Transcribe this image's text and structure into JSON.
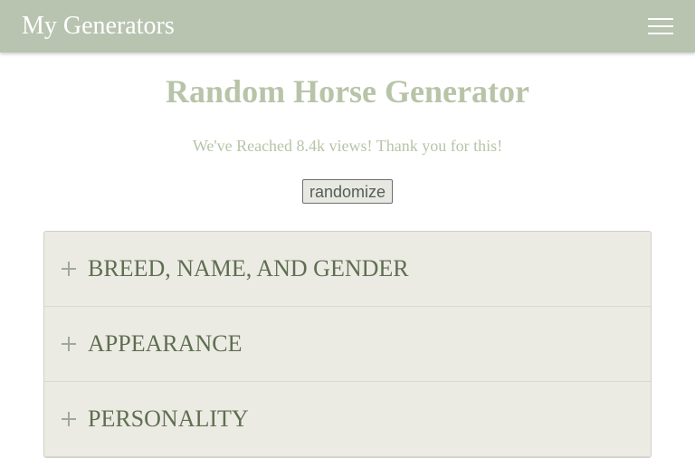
{
  "navbar": {
    "brand": "My Generators",
    "menu_icon": "hamburger-menu-icon"
  },
  "main": {
    "title": "Random Horse Generator",
    "views_text": "We've Reached 8.4k views! Thank you for this!",
    "randomize_label": "randomize"
  },
  "accordion": {
    "items": [
      {
        "label": "BREED, NAME, AND GENDER",
        "icon": "plus-icon"
      },
      {
        "label": "APPEARANCE",
        "icon": "plus-icon"
      },
      {
        "label": "PERSONALITY",
        "icon": "plus-icon"
      }
    ]
  },
  "colors": {
    "navbar_bg": "#b8c4b0",
    "title": "#b8c4a8",
    "accordion_bg": "#ecebe3",
    "accordion_text": "#5e6e52"
  }
}
